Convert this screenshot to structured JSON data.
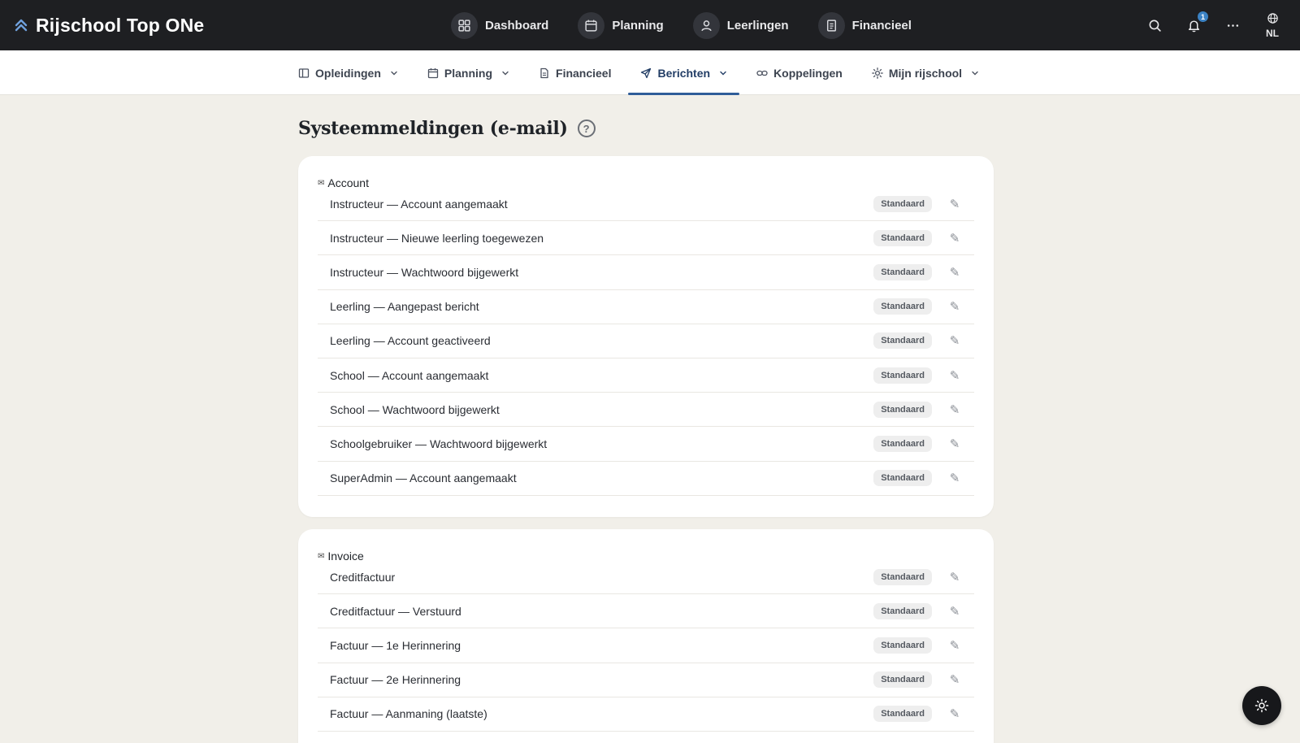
{
  "app": {
    "title": "Rijschool Top ONe"
  },
  "main_nav": [
    {
      "label": "Dashboard",
      "icon": "dashboard-icon"
    },
    {
      "label": "Planning",
      "icon": "calendar-icon"
    },
    {
      "label": "Leerlingen",
      "icon": "user-icon"
    },
    {
      "label": "Financieel",
      "icon": "receipt-icon"
    }
  ],
  "top_right": {
    "notification_count": "1",
    "language": "NL"
  },
  "sub_nav": [
    {
      "label": "Opleidingen",
      "icon": "columns-icon",
      "dropdown": true
    },
    {
      "label": "Planning",
      "icon": "calendar-icon",
      "dropdown": true
    },
    {
      "label": "Financieel",
      "icon": "document-icon",
      "dropdown": false
    },
    {
      "label": "Berichten",
      "icon": "send-icon",
      "dropdown": true,
      "active": true
    },
    {
      "label": "Koppelingen",
      "icon": "link-icon",
      "dropdown": false
    },
    {
      "label": "Mijn rijschool",
      "icon": "settings-icon",
      "dropdown": true
    }
  ],
  "page": {
    "title": "Systeemmeldingen (e-mail)",
    "help": "?"
  },
  "sections": {
    "account": {
      "title": "Account",
      "items": [
        {
          "label": "Instructeur — Account aangemaakt",
          "badge": "Standaard"
        },
        {
          "label": "Instructeur — Nieuwe leerling toegewezen",
          "badge": "Standaard"
        },
        {
          "label": "Instructeur — Wachtwoord bijgewerkt",
          "badge": "Standaard"
        },
        {
          "label": "Leerling — Aangepast bericht",
          "badge": "Standaard"
        },
        {
          "label": "Leerling — Account geactiveerd",
          "badge": "Standaard"
        },
        {
          "label": "School — Account aangemaakt",
          "badge": "Standaard"
        },
        {
          "label": "School — Wachtwoord bijgewerkt",
          "badge": "Standaard"
        },
        {
          "label": "Schoolgebruiker — Wachtwoord bijgewerkt",
          "badge": "Standaard"
        },
        {
          "label": "SuperAdmin — Account aangemaakt",
          "badge": "Standaard"
        }
      ]
    },
    "invoice": {
      "title": "Invoice",
      "items": [
        {
          "label": "Creditfactuur",
          "badge": "Standaard"
        },
        {
          "label": "Creditfactuur — Verstuurd",
          "badge": "Standaard"
        },
        {
          "label": "Factuur — 1e Herinnering",
          "badge": "Standaard"
        },
        {
          "label": "Factuur — 2e Herinnering",
          "badge": "Standaard"
        },
        {
          "label": "Factuur — Aanmaning (laatste)",
          "badge": "Standaard"
        }
      ]
    }
  },
  "colors": {
    "topbar": "#1e1f22",
    "background": "#f1efe9",
    "accent": "#2f5d99"
  }
}
